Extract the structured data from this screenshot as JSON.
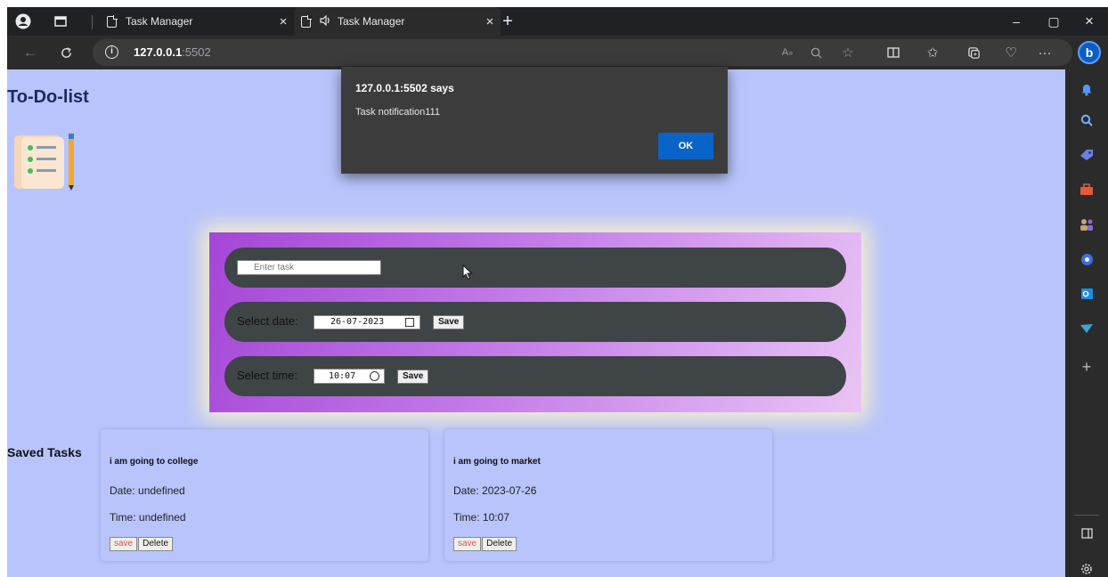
{
  "browser": {
    "tabs": [
      {
        "title": "Task Manager",
        "active": false
      },
      {
        "title": "Task Manager",
        "active": true
      }
    ],
    "url_host": "127.0.0.1",
    "url_port": ":5502",
    "close_glyph": "×",
    "new_tab_glyph": "+",
    "window_controls": {
      "minimize": "–",
      "maximize": "▢",
      "close": "×"
    },
    "bing_label": "b"
  },
  "page": {
    "title": "To-Do-list",
    "form": {
      "task_placeholder": "Enter task",
      "date_label": "Select date:",
      "date_value": "26-07-2023",
      "date_save": "Save",
      "time_label": "Select time:",
      "time_value": "10:07",
      "time_save": "Save"
    },
    "saved_tasks_label": "Saved Tasks",
    "tasks": [
      {
        "name": "i am going to college",
        "date": "Date: undefined",
        "time": "Time: undefined",
        "save": "save",
        "delete": "Delete"
      },
      {
        "name": "i am going to market",
        "date": "Date: 2023-07-26",
        "time": "Time: 10:07",
        "save": "save",
        "delete": "Delete"
      }
    ]
  },
  "alert": {
    "title": "127.0.0.1:5502 says",
    "message": "Task notification111",
    "ok": "OK"
  },
  "colors": {
    "page_bg": "#b8c4fb",
    "card_gradient_start": "#a446d6",
    "row_bg": "#3f4446",
    "ok_button": "#0a63c7"
  },
  "icons": {
    "sidebar": [
      "bell-icon",
      "search-icon",
      "tag-icon",
      "briefcase-icon",
      "people-icon",
      "copilot-icon",
      "outlook-icon",
      "send-icon",
      "add-icon",
      "split-screen-icon",
      "settings-icon"
    ]
  }
}
